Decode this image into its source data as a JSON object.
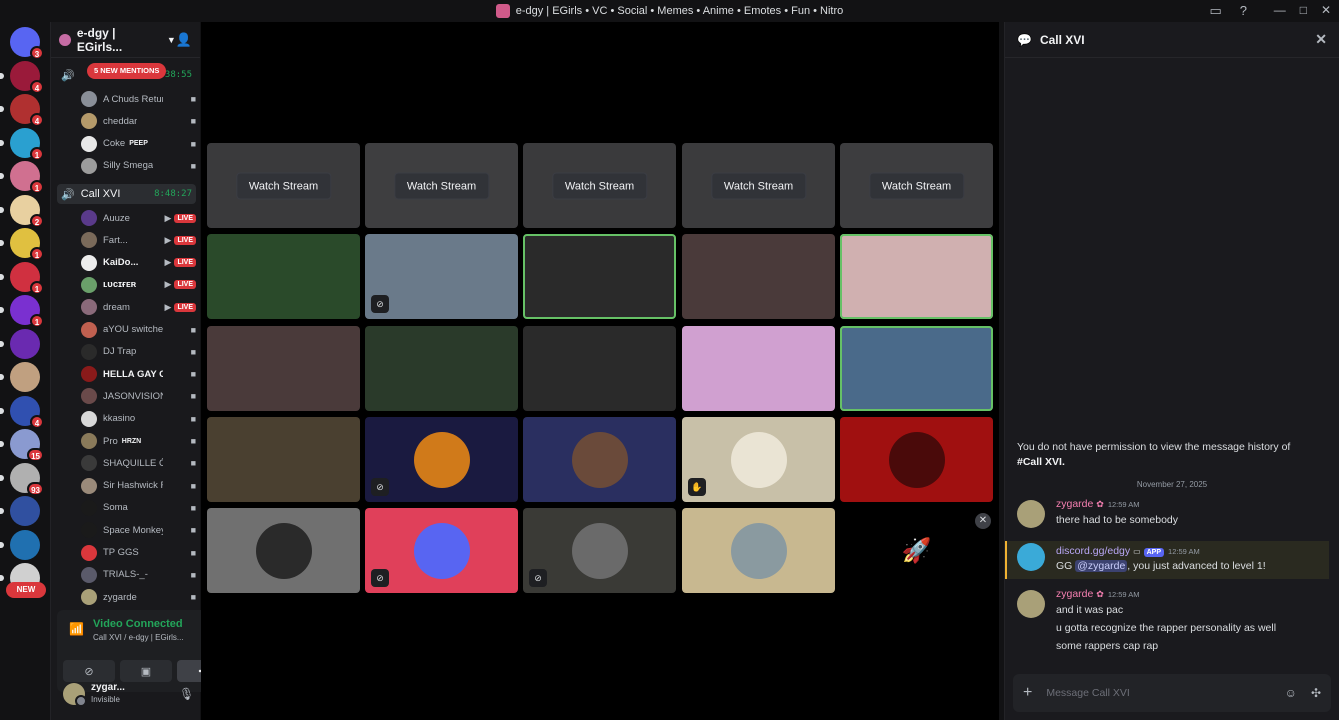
{
  "window": {
    "title": "e-dgy | EGirls • VC • Social • Memes • Anime • Emotes • Fun • Nitro"
  },
  "servers": [
    {
      "badge": "3"
    },
    {
      "badge": "4"
    },
    {
      "badge": "4"
    },
    {
      "badge": "1"
    },
    {
      "badge": "1"
    },
    {
      "badge": "2"
    },
    {
      "badge": "1"
    },
    {
      "badge": "1"
    },
    {
      "badge": "1"
    },
    {
      "badge": ""
    },
    {
      "badge": ""
    },
    {
      "badge": "4"
    },
    {
      "badge": "15"
    },
    {
      "badge": "93"
    },
    {
      "badge": ""
    },
    {
      "badge": ""
    },
    {
      "badge": ""
    }
  ],
  "new_pill": "NEW",
  "guild": {
    "name": "e-dgy | EGirls..."
  },
  "mention_pill": "5 NEW MENTIONS",
  "voice1": {
    "timer": "38:55"
  },
  "voice1_users": [
    {
      "name": "A Chuds Return",
      "tag": "",
      "live": "",
      "color": "#8a8f98"
    },
    {
      "name": "cheddar",
      "tag": "",
      "live": "",
      "color": "#b59a6a"
    },
    {
      "name": "Coke",
      "tag": "PEEP",
      "live": "",
      "color": "#e8e8e8"
    },
    {
      "name": "Silly Smega",
      "tag": "",
      "live": "",
      "color": "#9c9c9c"
    }
  ],
  "voice2": {
    "name": "Call XVI",
    "timer": "8:48:27"
  },
  "voice2_users": [
    {
      "name": "Auuze",
      "tag": "",
      "live": "LIVE",
      "color": "#5a3a8a"
    },
    {
      "name": "Fart...",
      "tag": "",
      "live": "LIVE",
      "color": "#7a6a5a"
    },
    {
      "name": "KaiDo...",
      "tag": "",
      "live": "LIVE",
      "color": "#ececec"
    },
    {
      "name": "ʟᴜᴄɪғᴇʀ",
      "tag": "",
      "live": "LIVE",
      "color": "#6aa06a"
    },
    {
      "name": "dream",
      "tag": "",
      "live": "LIVE",
      "color": "#8a6a7a"
    },
    {
      "name": "aYOU switche...",
      "tag": "",
      "live": "",
      "color": "#c06050"
    },
    {
      "name": "DJ Trap",
      "tag": "",
      "live": "",
      "color": "#2a2a2a"
    },
    {
      "name": "HELLA GAY C...",
      "tag": "",
      "live": "",
      "color": "#8a1a1a"
    },
    {
      "name": "JASONVISION...",
      "tag": "",
      "live": "",
      "color": "#6a4a4a"
    },
    {
      "name": "kkasino",
      "tag": "",
      "live": "",
      "color": "#d8d8d8"
    },
    {
      "name": "Pro",
      "tag": "HRZN",
      "live": "",
      "color": "#8a7a5a"
    },
    {
      "name": "SHAQUILLE Ó ÁN...",
      "tag": "",
      "live": "",
      "color": "#3a3a3a"
    },
    {
      "name": "Sir Hashwick R...",
      "tag": "",
      "live": "",
      "color": "#9a8a7a"
    },
    {
      "name": "Soma",
      "tag": "",
      "live": "",
      "color": "#1a1a1a"
    },
    {
      "name": "Space Monkeys",
      "tag": "",
      "live": "",
      "color": "#1a1a1a"
    },
    {
      "name": "TP GGS",
      "tag": "",
      "live": "",
      "color": "#da373c"
    },
    {
      "name": "TRIALS-_-",
      "tag": "",
      "live": "",
      "color": "#5a5a6a"
    },
    {
      "name": "zygarde",
      "tag": "",
      "live": "",
      "color": "#a9a078"
    }
  ],
  "vc": {
    "status": "Video Connected",
    "sub": "Call XVI / e-dgy | EGirls..."
  },
  "user": {
    "name": "zygar...",
    "status": "Invisible"
  },
  "stage": {
    "watch_label": "Watch Stream"
  },
  "chat": {
    "title": "Call XVI",
    "noperm_text": "You do not have permission to view the message history of",
    "noperm_channel": "#Call XVI.",
    "date": "November 27, 2025",
    "m1": {
      "author": "zygarde",
      "time": "12:59 AM",
      "lines": [
        "there had to be somebody"
      ]
    },
    "m2": {
      "author": "discord.gg/edgy",
      "app": "APP",
      "time": "12:59 AM",
      "pre": "GG ",
      "mention": "@zygarde",
      "post": ", you just advanced to level 1!"
    },
    "m3": {
      "author": "zygarde",
      "time": "12:59 AM",
      "lines": [
        "and it was pac",
        "u gotta recognize the rapper personality as well",
        "some rappers cap rap"
      ]
    },
    "placeholder": "Message Call XVI"
  }
}
